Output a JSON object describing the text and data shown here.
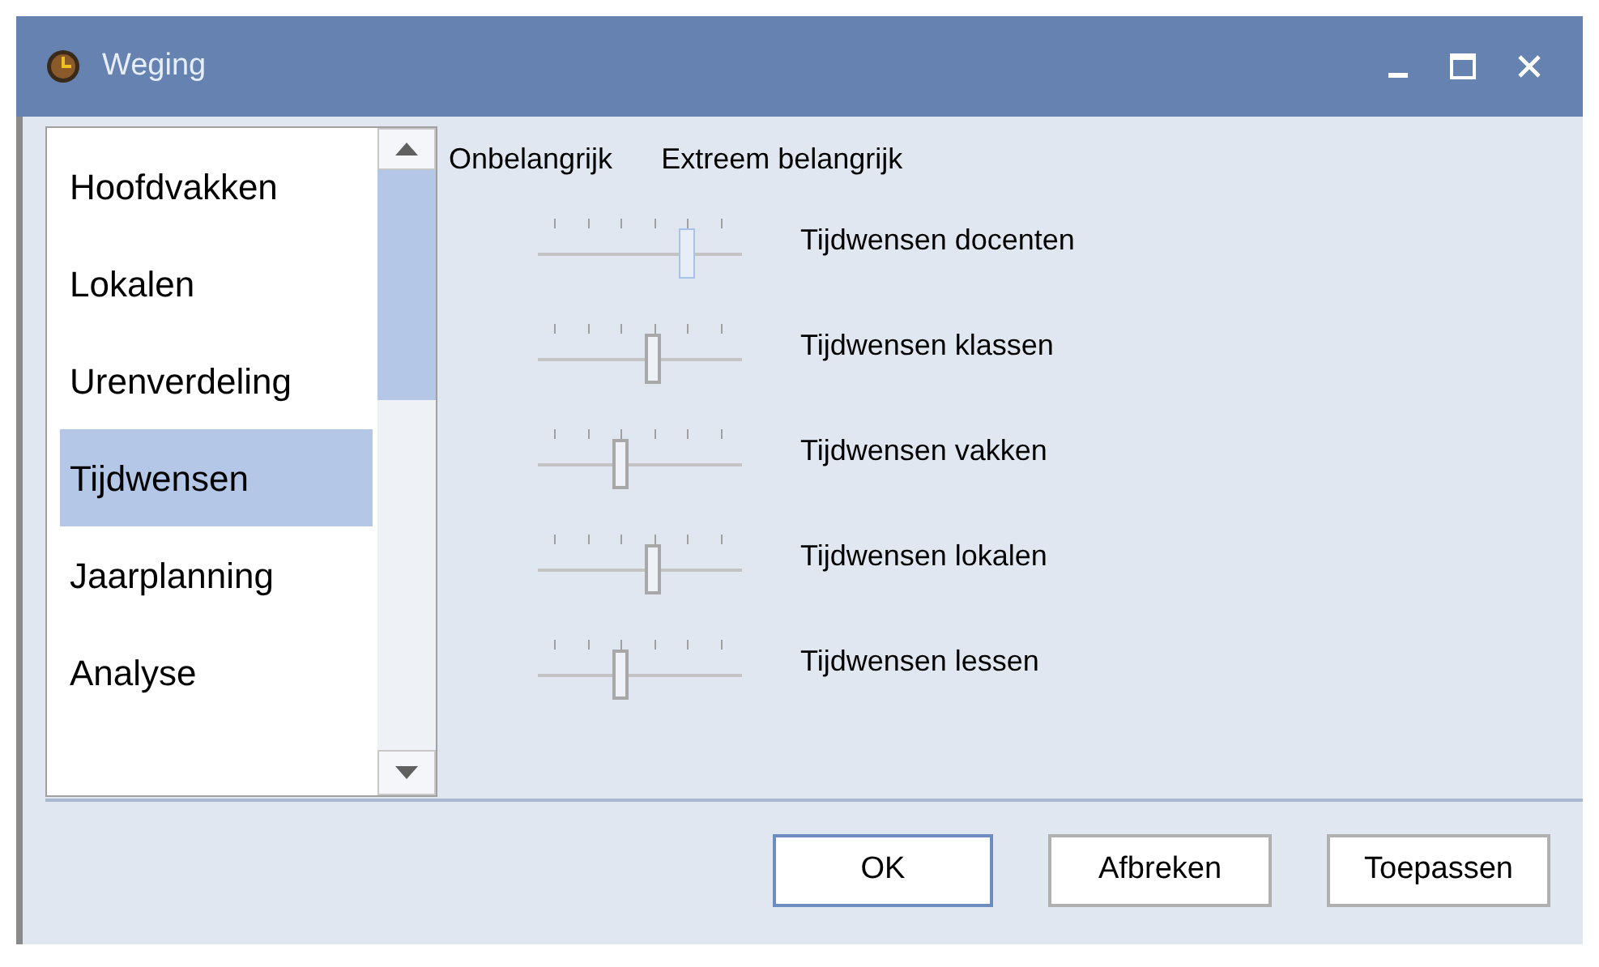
{
  "window": {
    "title": "Weging"
  },
  "sidebar": {
    "items": [
      {
        "label": "Hoofdvakken",
        "selected": false
      },
      {
        "label": "Lokalen",
        "selected": false
      },
      {
        "label": "Urenverdeling",
        "selected": false
      },
      {
        "label": "Tijdwensen",
        "selected": true
      },
      {
        "label": "Jaarplanning",
        "selected": false
      },
      {
        "label": "Analyse",
        "selected": false
      }
    ]
  },
  "scale": {
    "low_label": "Onbelangrijk",
    "high_label": "Extreem belangrijk"
  },
  "sliders": [
    {
      "label": "Tijdwensen docenten",
      "level": 0.8,
      "focused": true
    },
    {
      "label": "Tijdwensen klassen",
      "level": 0.6,
      "focused": false
    },
    {
      "label": "Tijdwensen vakken",
      "level": 0.4,
      "focused": false
    },
    {
      "label": "Tijdwensen lokalen",
      "level": 0.6,
      "focused": false
    },
    {
      "label": "Tijdwensen lessen",
      "level": 0.4,
      "focused": false
    }
  ],
  "buttons": [
    {
      "label": "OK",
      "default": true
    },
    {
      "label": "Afbreken",
      "default": false
    },
    {
      "label": "Toepassen",
      "default": false
    }
  ]
}
